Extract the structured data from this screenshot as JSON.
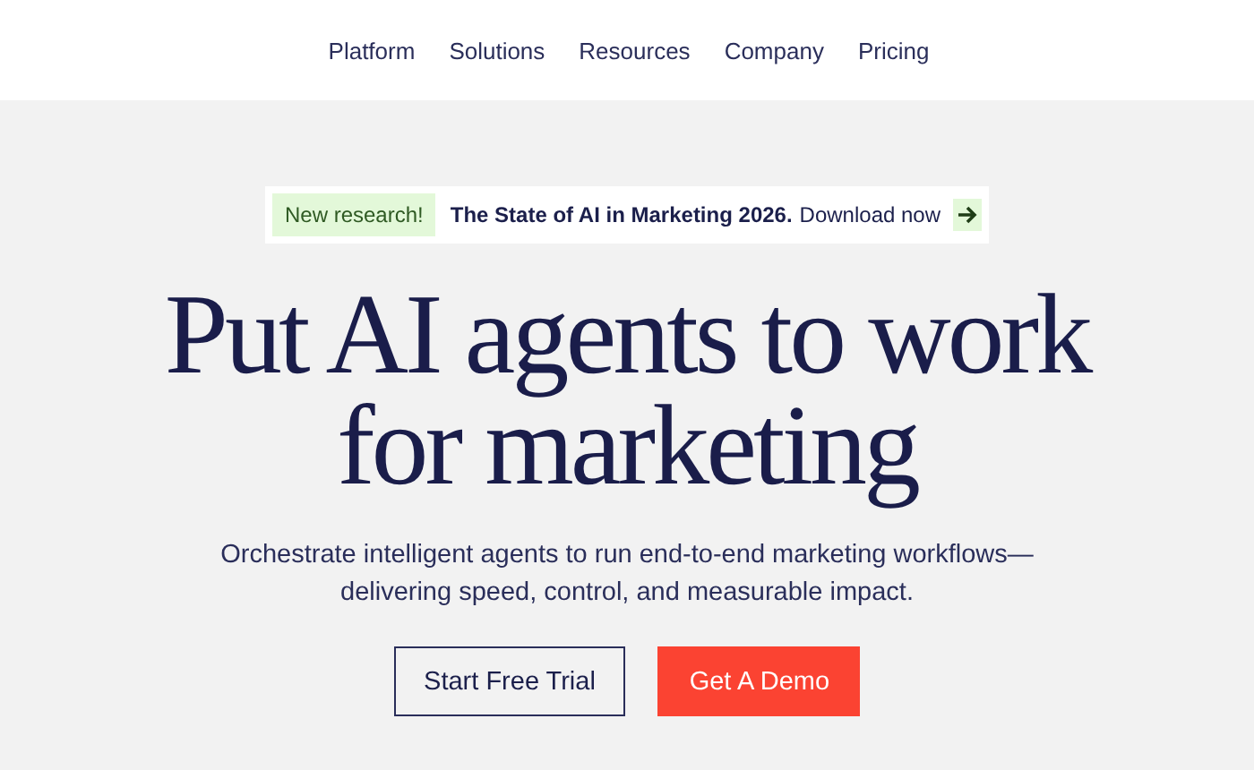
{
  "nav": {
    "items": [
      "Platform",
      "Solutions",
      "Resources",
      "Company",
      "Pricing"
    ]
  },
  "announcement": {
    "tag": "New research!",
    "title": "The State of AI in Marketing 2026.",
    "link": "Download now"
  },
  "hero": {
    "headline_lines": [
      "Put AI agents to work",
      "for marketing"
    ],
    "subtitle_lines": [
      "Orchestrate intelligent agents to run end-to-end marketing workflows—",
      "delivering speed, control, and measurable impact."
    ]
  },
  "buttons": [
    {
      "label": "Start Free Trial",
      "kind": "outline"
    },
    {
      "label": "Get A Demo",
      "kind": "primary"
    }
  ]
}
